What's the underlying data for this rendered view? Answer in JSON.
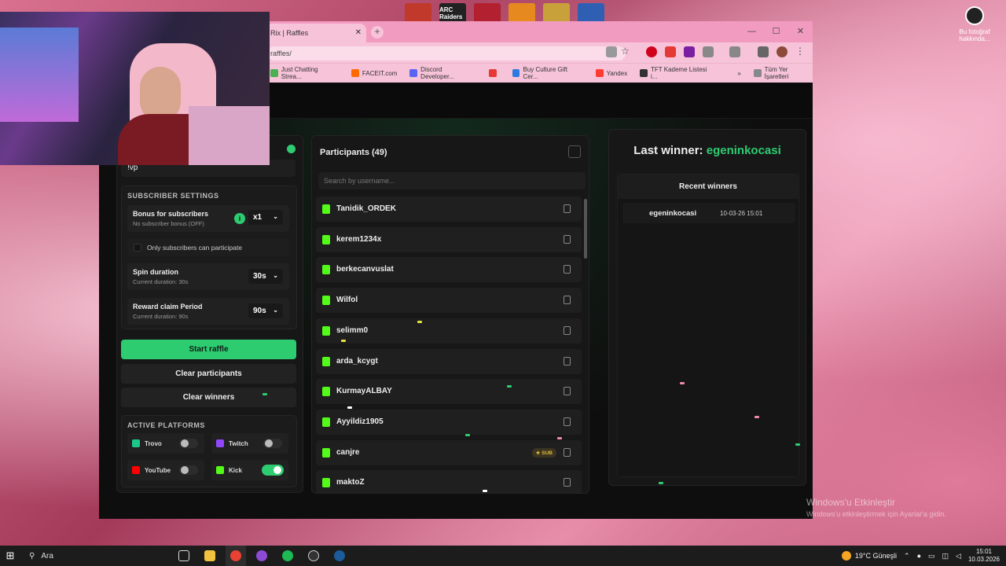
{
  "desktop": {
    "top_icons": [
      {
        "name": "faceit-shield-icon",
        "label": "",
        "color": "#c0392b"
      },
      {
        "name": "arc-raiders-icon",
        "label": "ARC Raiders",
        "color": "#222222"
      },
      {
        "name": "valorant-icon",
        "label": "",
        "color": "#b3202f"
      },
      {
        "name": "cs-icon",
        "label": "",
        "color": "#e68a1f"
      },
      {
        "name": "game-icon",
        "label": "",
        "color": "#c9a13a"
      },
      {
        "name": "capture-icon",
        "label": "",
        "color": "#2f5fb3"
      }
    ],
    "corner_label": "Bu fotoğraf hakkında...",
    "activation_title": "Windows'u Etkinleştir",
    "activation_sub": "Windows'u etkinleştirmek için Ayarlar'a gidin."
  },
  "browser": {
    "tab_title": "Rix | Raffles",
    "url": "raffles/",
    "bookmarks": [
      {
        "label": "Just Chatting Strea...",
        "color": "#4caf50"
      },
      {
        "label": "FACEIT.com",
        "color": "#ff6a00"
      },
      {
        "label": "Discord Developer...",
        "color": "#5865f2"
      },
      {
        "label": "",
        "color": "#e53935"
      },
      {
        "label": "Buy Culture Gift Cer...",
        "color": "#2d7be0"
      },
      {
        "label": "Yandex",
        "color": "#ff3b30"
      },
      {
        "label": "TFT Kademe Listesi i...",
        "color": "#333333"
      },
      {
        "label": "»",
        "color": "transparent"
      },
      {
        "label": "Tüm Yer İşaretleri",
        "color": "#888888"
      }
    ]
  },
  "left": {
    "command": "!vp",
    "subscriber_heading": "SUBSCRIBER SETTINGS",
    "bonus_title": "Bonus for subscribers",
    "bonus_sub": "No subscriber bonus (OFF)",
    "bonus_value": "x1",
    "only_subs": "Only subscribers can participate",
    "spin_title": "Spin duration",
    "spin_sub": "Current duration: 30s",
    "spin_value": "30s",
    "claim_title": "Reward claim Period",
    "claim_sub": "Current duration: 90s",
    "claim_value": "90s",
    "start": "Start raffle",
    "clear_participants": "Clear participants",
    "clear_winners": "Clear winners",
    "platforms_heading": "ACTIVE PLATFORMS",
    "platforms": [
      {
        "name": "Trovo",
        "on": false,
        "color": "#1bc88a"
      },
      {
        "name": "Twitch",
        "on": false,
        "color": "#9146ff"
      },
      {
        "name": "YouTube",
        "on": false,
        "color": "#ff0000"
      },
      {
        "name": "Kick",
        "on": true,
        "color": "#53fc18"
      }
    ]
  },
  "participants": {
    "title": "Participants (49)",
    "search_placeholder": "Search by username...",
    "sub_badge": "★ SUB",
    "list": [
      {
        "name": "Tanidik_ORDEK",
        "sub": false
      },
      {
        "name": "kerem1234x",
        "sub": false
      },
      {
        "name": "berkecanvuslat",
        "sub": false
      },
      {
        "name": "Wilfol",
        "sub": false
      },
      {
        "name": "selimm0",
        "sub": false
      },
      {
        "name": "arda_kcygt",
        "sub": false
      },
      {
        "name": "KurmayALBAY",
        "sub": false
      },
      {
        "name": "Ayyildiz1905",
        "sub": false
      },
      {
        "name": "canjre",
        "sub": true
      },
      {
        "name": "maktoZ",
        "sub": false
      }
    ]
  },
  "winners": {
    "last_label": "Last winner:",
    "last_name": "egeninkocasi",
    "recent_title": "Recent winners",
    "recent": [
      {
        "name": "egeninkocasi",
        "time": "10-03-26 15:01"
      }
    ]
  },
  "taskbar": {
    "search": "Ara",
    "weather": "19°C Güneşli",
    "time": "15:01",
    "date": "10.03.2026"
  }
}
